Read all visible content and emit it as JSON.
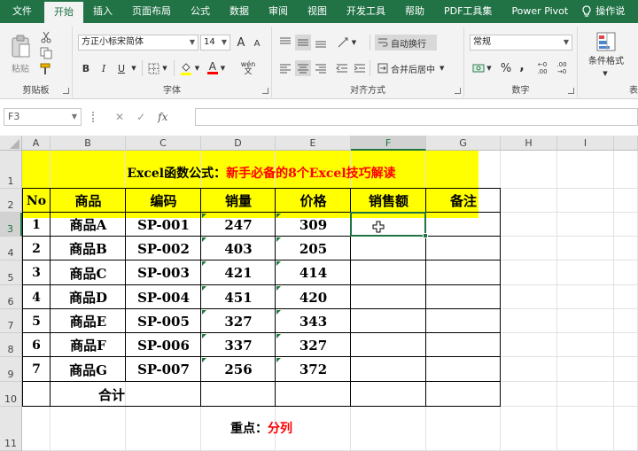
{
  "tabs": [
    "文件",
    "开始",
    "插入",
    "页面布局",
    "公式",
    "数据",
    "审阅",
    "视图",
    "开发工具",
    "帮助",
    "PDF工具集",
    "Power Pivot",
    "操作说"
  ],
  "active_tab_index": 1,
  "ribbon": {
    "clipboard": {
      "label": "剪贴板",
      "paste": "粘贴"
    },
    "font": {
      "label": "字体",
      "name": "方正小标宋简体",
      "size": "14",
      "grow": "A",
      "shrink": "A",
      "bold": "B",
      "italic": "I",
      "underline": "U",
      "font_color_glyph": "A",
      "phonetic": "wén"
    },
    "alignment": {
      "label": "对齐方式",
      "wrap": "自动换行",
      "merge": "合并后居中"
    },
    "number": {
      "label": "数字",
      "format": "常规",
      "percent": "%",
      "comma": ","
    },
    "styles": {
      "conditional": "条件格式",
      "table": "表"
    }
  },
  "formula_bar": {
    "name_box": "F3",
    "cancel": "✕",
    "enter": "✓",
    "fx": "fx",
    "formula": ""
  },
  "columns": [
    "A",
    "B",
    "C",
    "D",
    "E",
    "F",
    "G",
    "H",
    "I"
  ],
  "rows": [
    "1",
    "2",
    "3",
    "4",
    "5",
    "6",
    "7",
    "8",
    "9",
    "10",
    "11"
  ],
  "selected_cell": "F3",
  "sheet": {
    "title_black": "Excel函数公式：",
    "title_red": "新手必备的8个Excel技巧解读",
    "headers": [
      "No",
      "商品",
      "编码",
      "销量",
      "价格",
      "销售额",
      "备注"
    ],
    "data": [
      [
        "1",
        "商品A",
        "SP-001",
        "247",
        "309"
      ],
      [
        "2",
        "商品B",
        "SP-002",
        "403",
        "205"
      ],
      [
        "3",
        "商品C",
        "SP-003",
        "421",
        "414"
      ],
      [
        "4",
        "商品D",
        "SP-004",
        "451",
        "420"
      ],
      [
        "5",
        "商品E",
        "SP-005",
        "327",
        "343"
      ],
      [
        "6",
        "商品F",
        "SP-006",
        "337",
        "327"
      ],
      [
        "7",
        "商品G",
        "SP-007",
        "256",
        "372"
      ]
    ],
    "total_label": "合计",
    "note_black": "重点：",
    "note_red": "分列"
  },
  "colors": {
    "excel_green": "#217346",
    "highlight": "#ffff00",
    "title_red": "#ff0000"
  }
}
